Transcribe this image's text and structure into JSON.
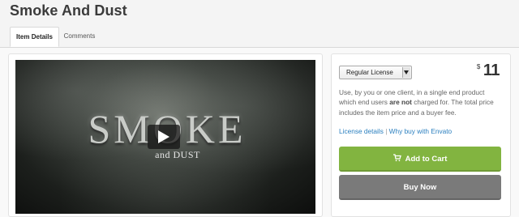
{
  "page": {
    "title": "Smoke And Dust"
  },
  "tabs": [
    {
      "label": "Item Details",
      "active": true
    },
    {
      "label": "Comments",
      "active": false
    }
  ],
  "preview": {
    "video_title_main": "SMOKE",
    "video_title_sub": "and DUST",
    "play_icon": "play-icon"
  },
  "license": {
    "selected_option": "Regular License",
    "price_currency": "$",
    "price_value": "11",
    "description_part1": "Use, by you or one client, in a single end product which end users ",
    "description_bold": "are not",
    "description_part2": " charged for. The total price includes the item price and a buyer fee.",
    "link_details": "License details",
    "link_separator": "|",
    "link_why_envato": "Why buy with Envato"
  },
  "actions": {
    "add_to_cart_label": "Add to Cart",
    "buy_now_label": "Buy Now",
    "add_to_cart_color": "#82b440",
    "buy_now_color": "#7a7a7a",
    "cart_icon": "cart-icon"
  }
}
